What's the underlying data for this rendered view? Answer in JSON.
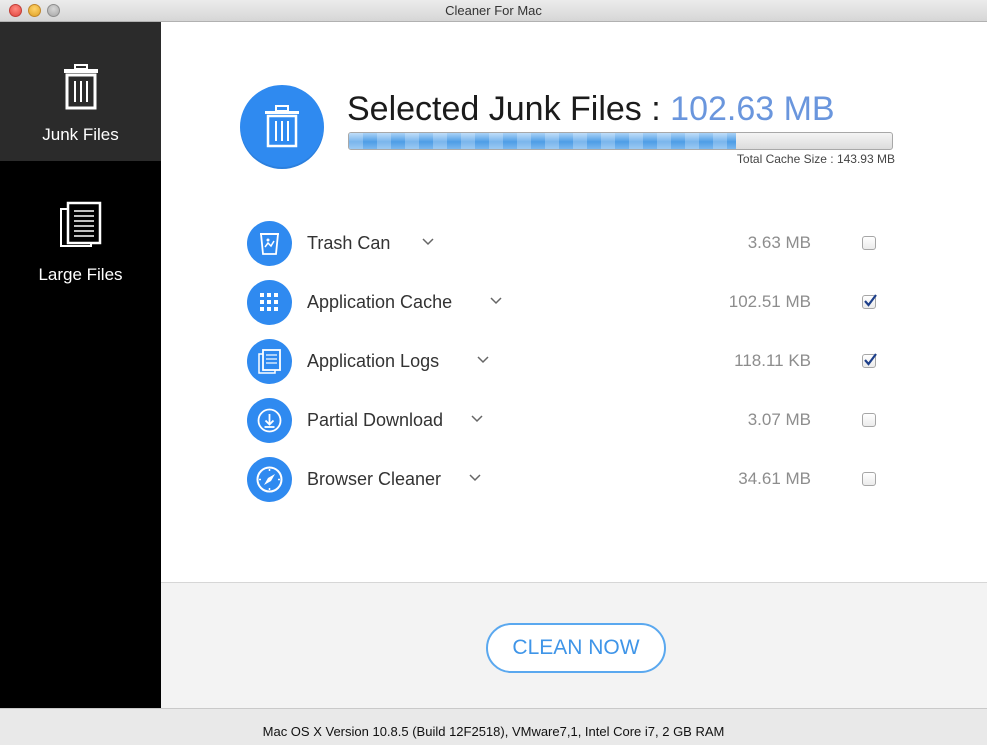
{
  "window": {
    "title": "Cleaner For Mac"
  },
  "sidebar": {
    "items": [
      {
        "label": "Junk Files",
        "icon": "trash-icon",
        "active": true
      },
      {
        "label": "Large Files",
        "icon": "documents-icon",
        "active": false
      }
    ]
  },
  "summary": {
    "heading_label": "Selected Junk Files : ",
    "selected_size": "102.63 MB",
    "total_label": "Total Cache Size : 143.93 MB",
    "progress_fraction": 0.713
  },
  "categories": [
    {
      "label": "Trash Can",
      "size": "3.63 MB",
      "checked": false,
      "icon": "trash-can-icon"
    },
    {
      "label": "Application Cache",
      "size": "102.51 MB",
      "checked": true,
      "icon": "grid-icon"
    },
    {
      "label": "Application Logs",
      "size": "118.11 KB",
      "checked": true,
      "icon": "logs-icon"
    },
    {
      "label": "Partial Download",
      "size": "3.07 MB",
      "checked": false,
      "icon": "download-icon"
    },
    {
      "label": "Browser Cleaner",
      "size": "34.61 MB",
      "checked": false,
      "icon": "compass-icon"
    }
  ],
  "actions": {
    "clean_label": "CLEAN NOW"
  },
  "status": {
    "text": "Mac OS X Version 10.8.5 (Build 12F2518), VMware7,1, Intel Core i7, 2 GB RAM"
  },
  "colors": {
    "accent": "#2f8af0",
    "size_highlight": "#6a96dd",
    "sidebar_bg": "#000000",
    "sidebar_active": "#2b2b2b"
  }
}
